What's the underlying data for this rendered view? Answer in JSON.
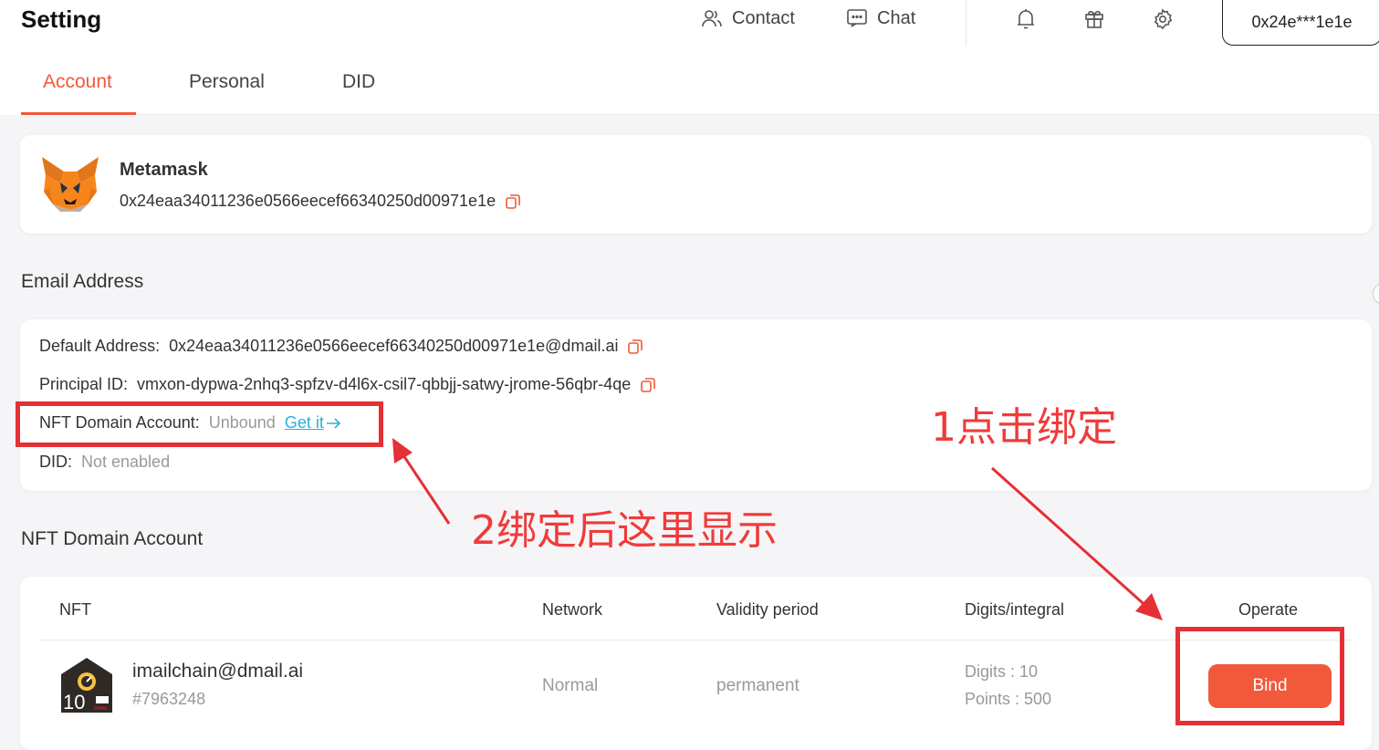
{
  "header": {
    "title": "Setting",
    "nav": [
      {
        "label": "Contact",
        "icon": "contacts-icon"
      },
      {
        "label": "Chat",
        "icon": "chat-icon"
      }
    ],
    "icons": [
      "bell-icon",
      "gift-icon",
      "gear-icon"
    ],
    "wallet_label": "0x24e***1e1e"
  },
  "tabs": [
    {
      "label": "Account",
      "active": true
    },
    {
      "label": "Personal",
      "active": false
    },
    {
      "label": "DID",
      "active": false
    }
  ],
  "wallet": {
    "name": "Metamask",
    "address": "0x24eaa34011236e0566eecef66340250d00971e1e",
    "icon": "metamask-fox-icon"
  },
  "email_section": {
    "title": "Email Address",
    "default_label": "Default Address:",
    "default_value": "0x24eaa34011236e0566eecef66340250d00971e1e@dmail.ai",
    "principal_label": "Principal ID:",
    "principal_value": "vmxon-dypwa-2nhq3-spfzv-d4l6x-csil7-qbbjj-satwy-jrome-56qbr-4qe",
    "nft_label": "NFT Domain Account:",
    "nft_value": "Unbound",
    "nft_link": "Get it",
    "did_label": "DID:",
    "did_value": "Not enabled"
  },
  "nft_section": {
    "title": "NFT Domain Account",
    "columns": [
      "NFT",
      "Network",
      "Validity period",
      "Digits/integral",
      "Operate"
    ],
    "rows": [
      {
        "name": "imailchain@dmail.ai",
        "id": "#7963248",
        "thumb_number": "10",
        "thumb_brand": "DMAIL",
        "network": "Normal",
        "validity": "permanent",
        "digits": "Digits : 10",
        "points": "Points : 500",
        "action": "Bind"
      }
    ]
  },
  "annotations": {
    "step1": "1点击绑定",
    "step2": "2绑定后这里显示",
    "color": "#e53035"
  },
  "colors": {
    "accent": "#f2583a",
    "link": "#2ab0d8"
  }
}
